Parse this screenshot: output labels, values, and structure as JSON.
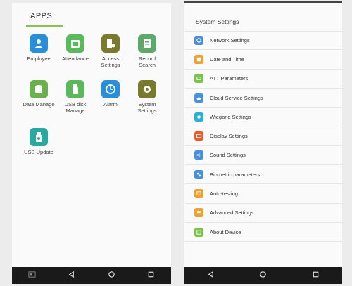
{
  "apps": {
    "title": "APPS",
    "items": [
      {
        "label": "Employee",
        "icon": "employee-icon",
        "color": "#2a8fd8"
      },
      {
        "label": "Attendance",
        "icon": "attendance-icon",
        "color": "#5cb85c"
      },
      {
        "label": "Access Settings",
        "icon": "access-settings-icon",
        "color": "#7a7a2e"
      },
      {
        "label": "Record Search",
        "icon": "record-search-icon",
        "color": "#5ea96a"
      },
      {
        "label": "Data Manage",
        "icon": "data-manage-icon",
        "color": "#6ab04c"
      },
      {
        "label": "USB disk Manage",
        "icon": "usb-disk-icon",
        "color": "#5cb85c"
      },
      {
        "label": "Alarm",
        "icon": "alarm-icon",
        "color": "#2a8fd8"
      },
      {
        "label": "System Settings",
        "icon": "system-settings-icon",
        "color": "#7a7a2e"
      },
      {
        "label": "USB Update",
        "icon": "usb-update-icon",
        "color": "#2aa9a0"
      }
    ]
  },
  "settings": {
    "title": "System Settings",
    "items": [
      {
        "label": "Network Settings",
        "icon": "network-icon",
        "color": "#4a90d9"
      },
      {
        "label": "Date and Time",
        "icon": "date-time-icon",
        "color": "#f0a030"
      },
      {
        "label": "ATT Parameters",
        "icon": "att-parameters-icon",
        "color": "#7cc24a"
      },
      {
        "label": "Cloud Service Settings",
        "icon": "cloud-icon",
        "color": "#4a90d9"
      },
      {
        "label": "Wiegand Settings",
        "icon": "wiegand-icon",
        "color": "#2ab0d0"
      },
      {
        "label": "Display Settings",
        "icon": "display-icon",
        "color": "#e85a2a"
      },
      {
        "label": "Sound Settings",
        "icon": "sound-icon",
        "color": "#4a90d9"
      },
      {
        "label": "Biometric parameters",
        "icon": "biometric-icon",
        "color": "#4a90d9"
      },
      {
        "label": "Auto-testing",
        "icon": "auto-testing-icon",
        "color": "#f0a030"
      },
      {
        "label": "Advanced Settings",
        "icon": "advanced-icon",
        "color": "#f0a030"
      },
      {
        "label": "About Device",
        "icon": "about-icon",
        "color": "#7cc24a"
      }
    ]
  },
  "navbar": {
    "buttons": [
      "menu-icon",
      "back-icon",
      "home-icon",
      "recents-icon"
    ]
  }
}
